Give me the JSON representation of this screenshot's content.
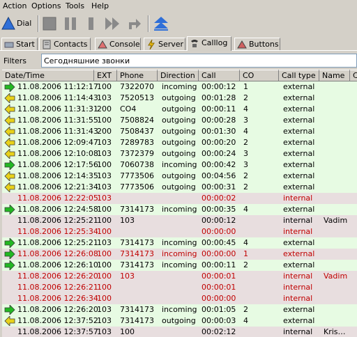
{
  "menu": [
    "Action",
    "Options",
    "Tools",
    "Help"
  ],
  "toolbar": {
    "dial_label": "Dial"
  },
  "tabs": [
    {
      "label": "Start",
      "icon": "start-icon"
    },
    {
      "label": "Contacts",
      "icon": "contacts-icon"
    },
    {
      "label": "Console",
      "icon": "console-icon"
    },
    {
      "label": "Server",
      "icon": "server-icon"
    },
    {
      "label": "Calllog",
      "icon": "calllog-icon"
    },
    {
      "label": "Buttons",
      "icon": "buttons-icon"
    }
  ],
  "filters": {
    "label": "Filters",
    "value": "Сегодняшние звонки"
  },
  "columns": [
    "Date/Time",
    "EXT",
    "Phone",
    "Direction",
    "Call",
    "CO",
    "Call type",
    "Name",
    "C"
  ],
  "colors": {
    "incoming_arrow": "#22b822",
    "outgoing_arrow": "#e8d21a",
    "missed_text": "#c00000",
    "answered_bg": "#e7fbe3",
    "missed_bg": "#e8dedf"
  },
  "rows": [
    {
      "arrow": "in",
      "datetime": "11.08.2006 11:12:17",
      "ext": "100",
      "phone": "7322070",
      "direction": "incoming",
      "call": "00:00:12",
      "co": "1",
      "type": "external",
      "name": "",
      "status": "green"
    },
    {
      "arrow": "out",
      "datetime": "11.08.2006 11:14:43",
      "ext": "103",
      "phone": "7520513",
      "direction": "outgoing",
      "call": "00:01:28",
      "co": "2",
      "type": "external",
      "name": "",
      "status": "green"
    },
    {
      "arrow": "out",
      "datetime": "11.08.2006 11:31:31",
      "ext": "200",
      "phone": "CO4",
      "direction": "outgoing",
      "call": "00:00:11",
      "co": "4",
      "type": "external",
      "name": "",
      "status": "green"
    },
    {
      "arrow": "out",
      "datetime": "11.08.2006 11:31:55",
      "ext": "100",
      "phone": "7508824",
      "direction": "outgoing",
      "call": "00:00:28",
      "co": "3",
      "type": "external",
      "name": "",
      "status": "green"
    },
    {
      "arrow": "out",
      "datetime": "11.08.2006 11:31:43",
      "ext": "200",
      "phone": "7508437",
      "direction": "outgoing",
      "call": "00:01:30",
      "co": "4",
      "type": "external",
      "name": "",
      "status": "green"
    },
    {
      "arrow": "out",
      "datetime": "11.08.2006 12:09:47",
      "ext": "103",
      "phone": "7289783",
      "direction": "outgoing",
      "call": "00:00:20",
      "co": "2",
      "type": "external",
      "name": "",
      "status": "green"
    },
    {
      "arrow": "out",
      "datetime": "11.08.2006 12:10:08",
      "ext": "103",
      "phone": "7372379",
      "direction": "outgoing",
      "call": "00:00:24",
      "co": "3",
      "type": "external",
      "name": "",
      "status": "green"
    },
    {
      "arrow": "in",
      "datetime": "11.08.2006 12:17:56",
      "ext": "100",
      "phone": "7060738",
      "direction": "incoming",
      "call": "00:00:42",
      "co": "3",
      "type": "external",
      "name": "",
      "status": "green"
    },
    {
      "arrow": "out",
      "datetime": "11.08.2006 12:14:35",
      "ext": "103",
      "phone": "7773506",
      "direction": "outgoing",
      "call": "00:04:56",
      "co": "2",
      "type": "external",
      "name": "",
      "status": "green"
    },
    {
      "arrow": "out",
      "datetime": "11.08.2006 12:21:34",
      "ext": "103",
      "phone": "7773506",
      "direction": "outgoing",
      "call": "00:00:31",
      "co": "2",
      "type": "external",
      "name": "",
      "status": "green"
    },
    {
      "arrow": "",
      "datetime": "11.08.2006 12:22:05",
      "ext": "103",
      "phone": "",
      "direction": "",
      "call": "00:00:02",
      "co": "",
      "type": "internal",
      "name": "",
      "status": "red"
    },
    {
      "arrow": "in",
      "datetime": "11.08.2006 12:24:58",
      "ext": "100",
      "phone": "7314173",
      "direction": "incoming",
      "call": "00:00:35",
      "co": "4",
      "type": "external",
      "name": "",
      "status": "green"
    },
    {
      "arrow": "",
      "datetime": "11.08.2006 12:25:21",
      "ext": "100",
      "phone": "103",
      "direction": "",
      "call": "00:00:12",
      "co": "",
      "type": "internal",
      "name": "Vadim",
      "status": "grey"
    },
    {
      "arrow": "",
      "datetime": "11.08.2006 12:25:34",
      "ext": "100",
      "phone": "",
      "direction": "",
      "call": "00:00:00",
      "co": "",
      "type": "internal",
      "name": "",
      "status": "red"
    },
    {
      "arrow": "in",
      "datetime": "11.08.2006 12:25:21",
      "ext": "103",
      "phone": "7314173",
      "direction": "incoming",
      "call": "00:00:45",
      "co": "4",
      "type": "external",
      "name": "",
      "status": "green"
    },
    {
      "arrow": "in",
      "datetime": "11.08.2006 12:26:08",
      "ext": "100",
      "phone": "7314173",
      "direction": "incoming",
      "call": "00:00:00",
      "co": "1",
      "type": "external",
      "name": "",
      "status": "red"
    },
    {
      "arrow": "in",
      "datetime": "11.08.2006 12:26:10",
      "ext": "100",
      "phone": "7314173",
      "direction": "incoming",
      "call": "00:00:11",
      "co": "2",
      "type": "external",
      "name": "",
      "status": "green"
    },
    {
      "arrow": "",
      "datetime": "11.08.2006 12:26:20",
      "ext": "100",
      "phone": "103",
      "direction": "",
      "call": "00:00:01",
      "co": "",
      "type": "internal",
      "name": "Vadim",
      "status": "red"
    },
    {
      "arrow": "",
      "datetime": "11.08.2006 12:26:21",
      "ext": "100",
      "phone": "",
      "direction": "",
      "call": "00:00:01",
      "co": "",
      "type": "internal",
      "name": "",
      "status": "red"
    },
    {
      "arrow": "",
      "datetime": "11.08.2006 12:26:34",
      "ext": "100",
      "phone": "",
      "direction": "",
      "call": "00:00:00",
      "co": "",
      "type": "internal",
      "name": "",
      "status": "red"
    },
    {
      "arrow": "in",
      "datetime": "11.08.2006 12:26:20",
      "ext": "103",
      "phone": "7314173",
      "direction": "incoming",
      "call": "00:01:05",
      "co": "2",
      "type": "external",
      "name": "",
      "status": "green"
    },
    {
      "arrow": "out",
      "datetime": "11.08.2006 12:37:52",
      "ext": "103",
      "phone": "7314173",
      "direction": "outgoing",
      "call": "00:00:03",
      "co": "4",
      "type": "external",
      "name": "",
      "status": "green"
    },
    {
      "arrow": "",
      "datetime": "11.08.2006 12:37:57",
      "ext": "103",
      "phone": "100",
      "direction": "",
      "call": "00:02:12",
      "co": "",
      "type": "internal",
      "name": "Kris…",
      "status": "grey"
    }
  ]
}
